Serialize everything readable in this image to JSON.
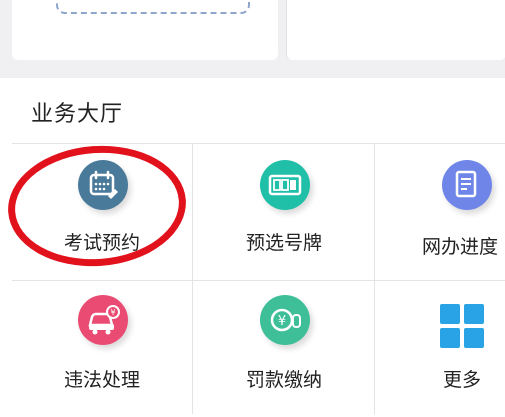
{
  "section": {
    "title": "业务大厅"
  },
  "services": [
    {
      "label": "考试预约",
      "icon": "calendar-edit-icon",
      "color": "#4a7a9a"
    },
    {
      "label": "预选号牌",
      "icon": "license-plate-icon",
      "color": "#1fbfa8"
    },
    {
      "label": "网办进度",
      "icon": "document-progress-icon",
      "color": "#6f86e8"
    },
    {
      "label": "违法处理",
      "icon": "car-violation-icon",
      "color": "#e94b73"
    },
    {
      "label": "罚款缴纳",
      "icon": "yuan-payment-icon",
      "color": "#3fbf98"
    },
    {
      "label": "更多",
      "icon": "grid-more-icon",
      "color": "#29a3e6"
    }
  ],
  "annotation": {
    "target": "考试预约",
    "color": "#e2121d"
  }
}
